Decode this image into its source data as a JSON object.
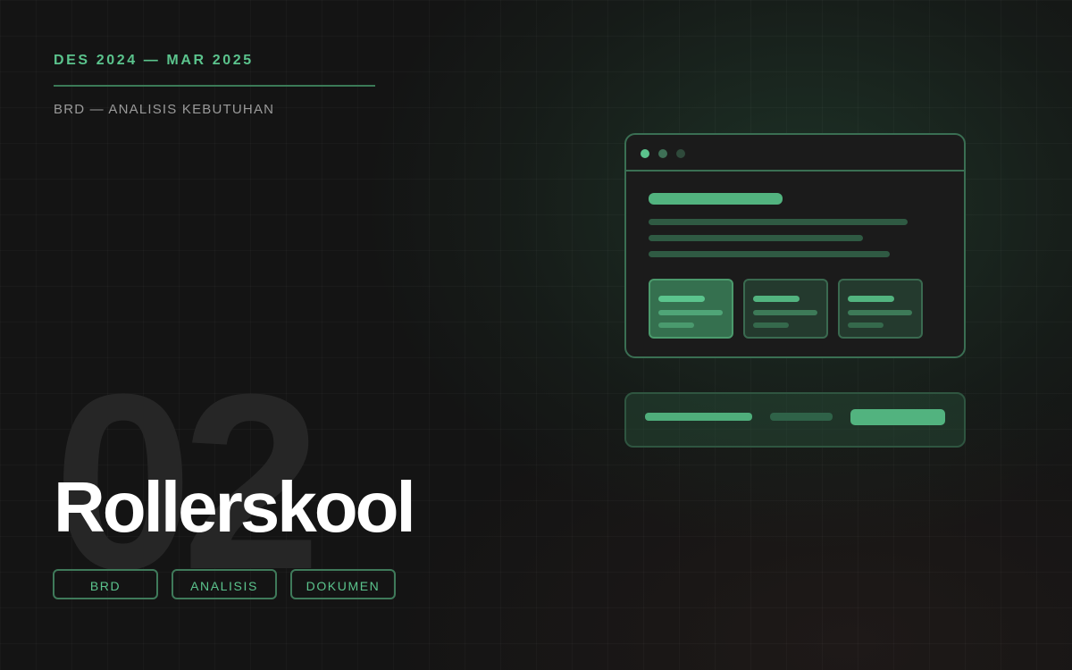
{
  "header": {
    "date_range": "DES 2024 — MAR 2025",
    "subtitle": "BRD — ANALISIS KEBUTUHAN"
  },
  "project": {
    "number": "02",
    "title": "Rollerskool",
    "tags": [
      "BRD",
      "ANALISIS",
      "DOKUMEN"
    ]
  },
  "colors": {
    "accent": "#5bc48d",
    "accent_dim": "#3b7a57",
    "background": "#141414"
  },
  "mockup": {
    "window_dots": [
      "active-dot",
      "dot",
      "dot"
    ],
    "cards": [
      "card-highlighted",
      "card",
      "card"
    ]
  }
}
